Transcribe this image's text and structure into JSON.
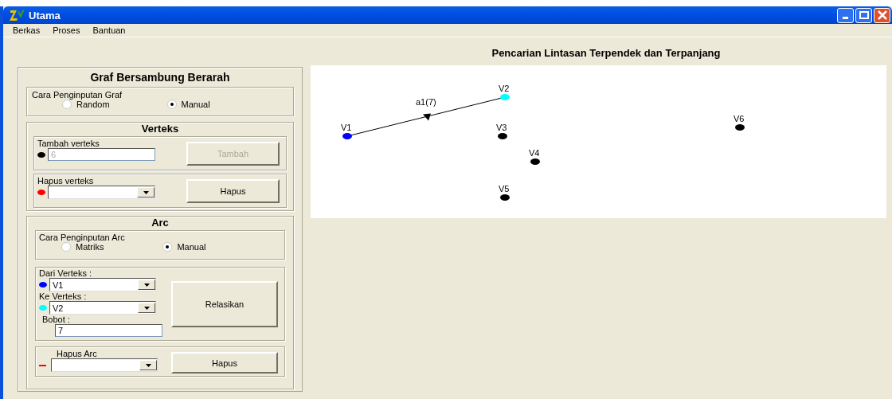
{
  "window": {
    "title": "Utama"
  },
  "menu": [
    {
      "label": "Berkas"
    },
    {
      "label": "Proses"
    },
    {
      "label": "Bantuan"
    }
  ],
  "heading": "Pencarian Lintasan Terpendek dan Terpanjang",
  "panel": {
    "title": "Graf Bersambung Berarah",
    "graph_input": {
      "label": "Cara Penginputan Graf",
      "options": [
        {
          "label": "Random",
          "selected": false
        },
        {
          "label": "Manual",
          "selected": true
        }
      ]
    },
    "vertex": {
      "title": "Verteks",
      "add": {
        "label": "Tambah verteks",
        "value": "6",
        "disabled": true,
        "button": "Tambah",
        "button_disabled": true,
        "color": "#000000"
      },
      "remove": {
        "label": "Hapus verteks",
        "button": "Hapus",
        "color": "#ff0000"
      }
    },
    "arc": {
      "title": "Arc",
      "arc_input": {
        "label": "Cara Penginputan Arc",
        "options": [
          {
            "label": "Matriks",
            "selected": false
          },
          {
            "label": "Manual",
            "selected": true
          }
        ]
      },
      "from": {
        "label": "Dari Verteks :",
        "value": "V1",
        "color": "#0000ff"
      },
      "to": {
        "label": "Ke Verteks :",
        "value": "V2",
        "color": "#00ffff"
      },
      "weight": {
        "label": "Bobot :",
        "value": "7"
      },
      "relate_button": "Relasikan",
      "remove": {
        "label": "Hapus Arc",
        "button": "Hapus",
        "color": "#ff0000"
      }
    }
  },
  "graph": {
    "nodes": [
      {
        "label": "V1",
        "color": "#0000ff"
      },
      {
        "label": "V2",
        "color": "#00ffff"
      },
      {
        "label": "V3",
        "color": "#000000"
      },
      {
        "label": "V4",
        "color": "#000000"
      },
      {
        "label": "V5",
        "color": "#000000"
      },
      {
        "label": "V6",
        "color": "#000000"
      }
    ],
    "edges": [
      {
        "label": "a1(7)"
      }
    ]
  }
}
